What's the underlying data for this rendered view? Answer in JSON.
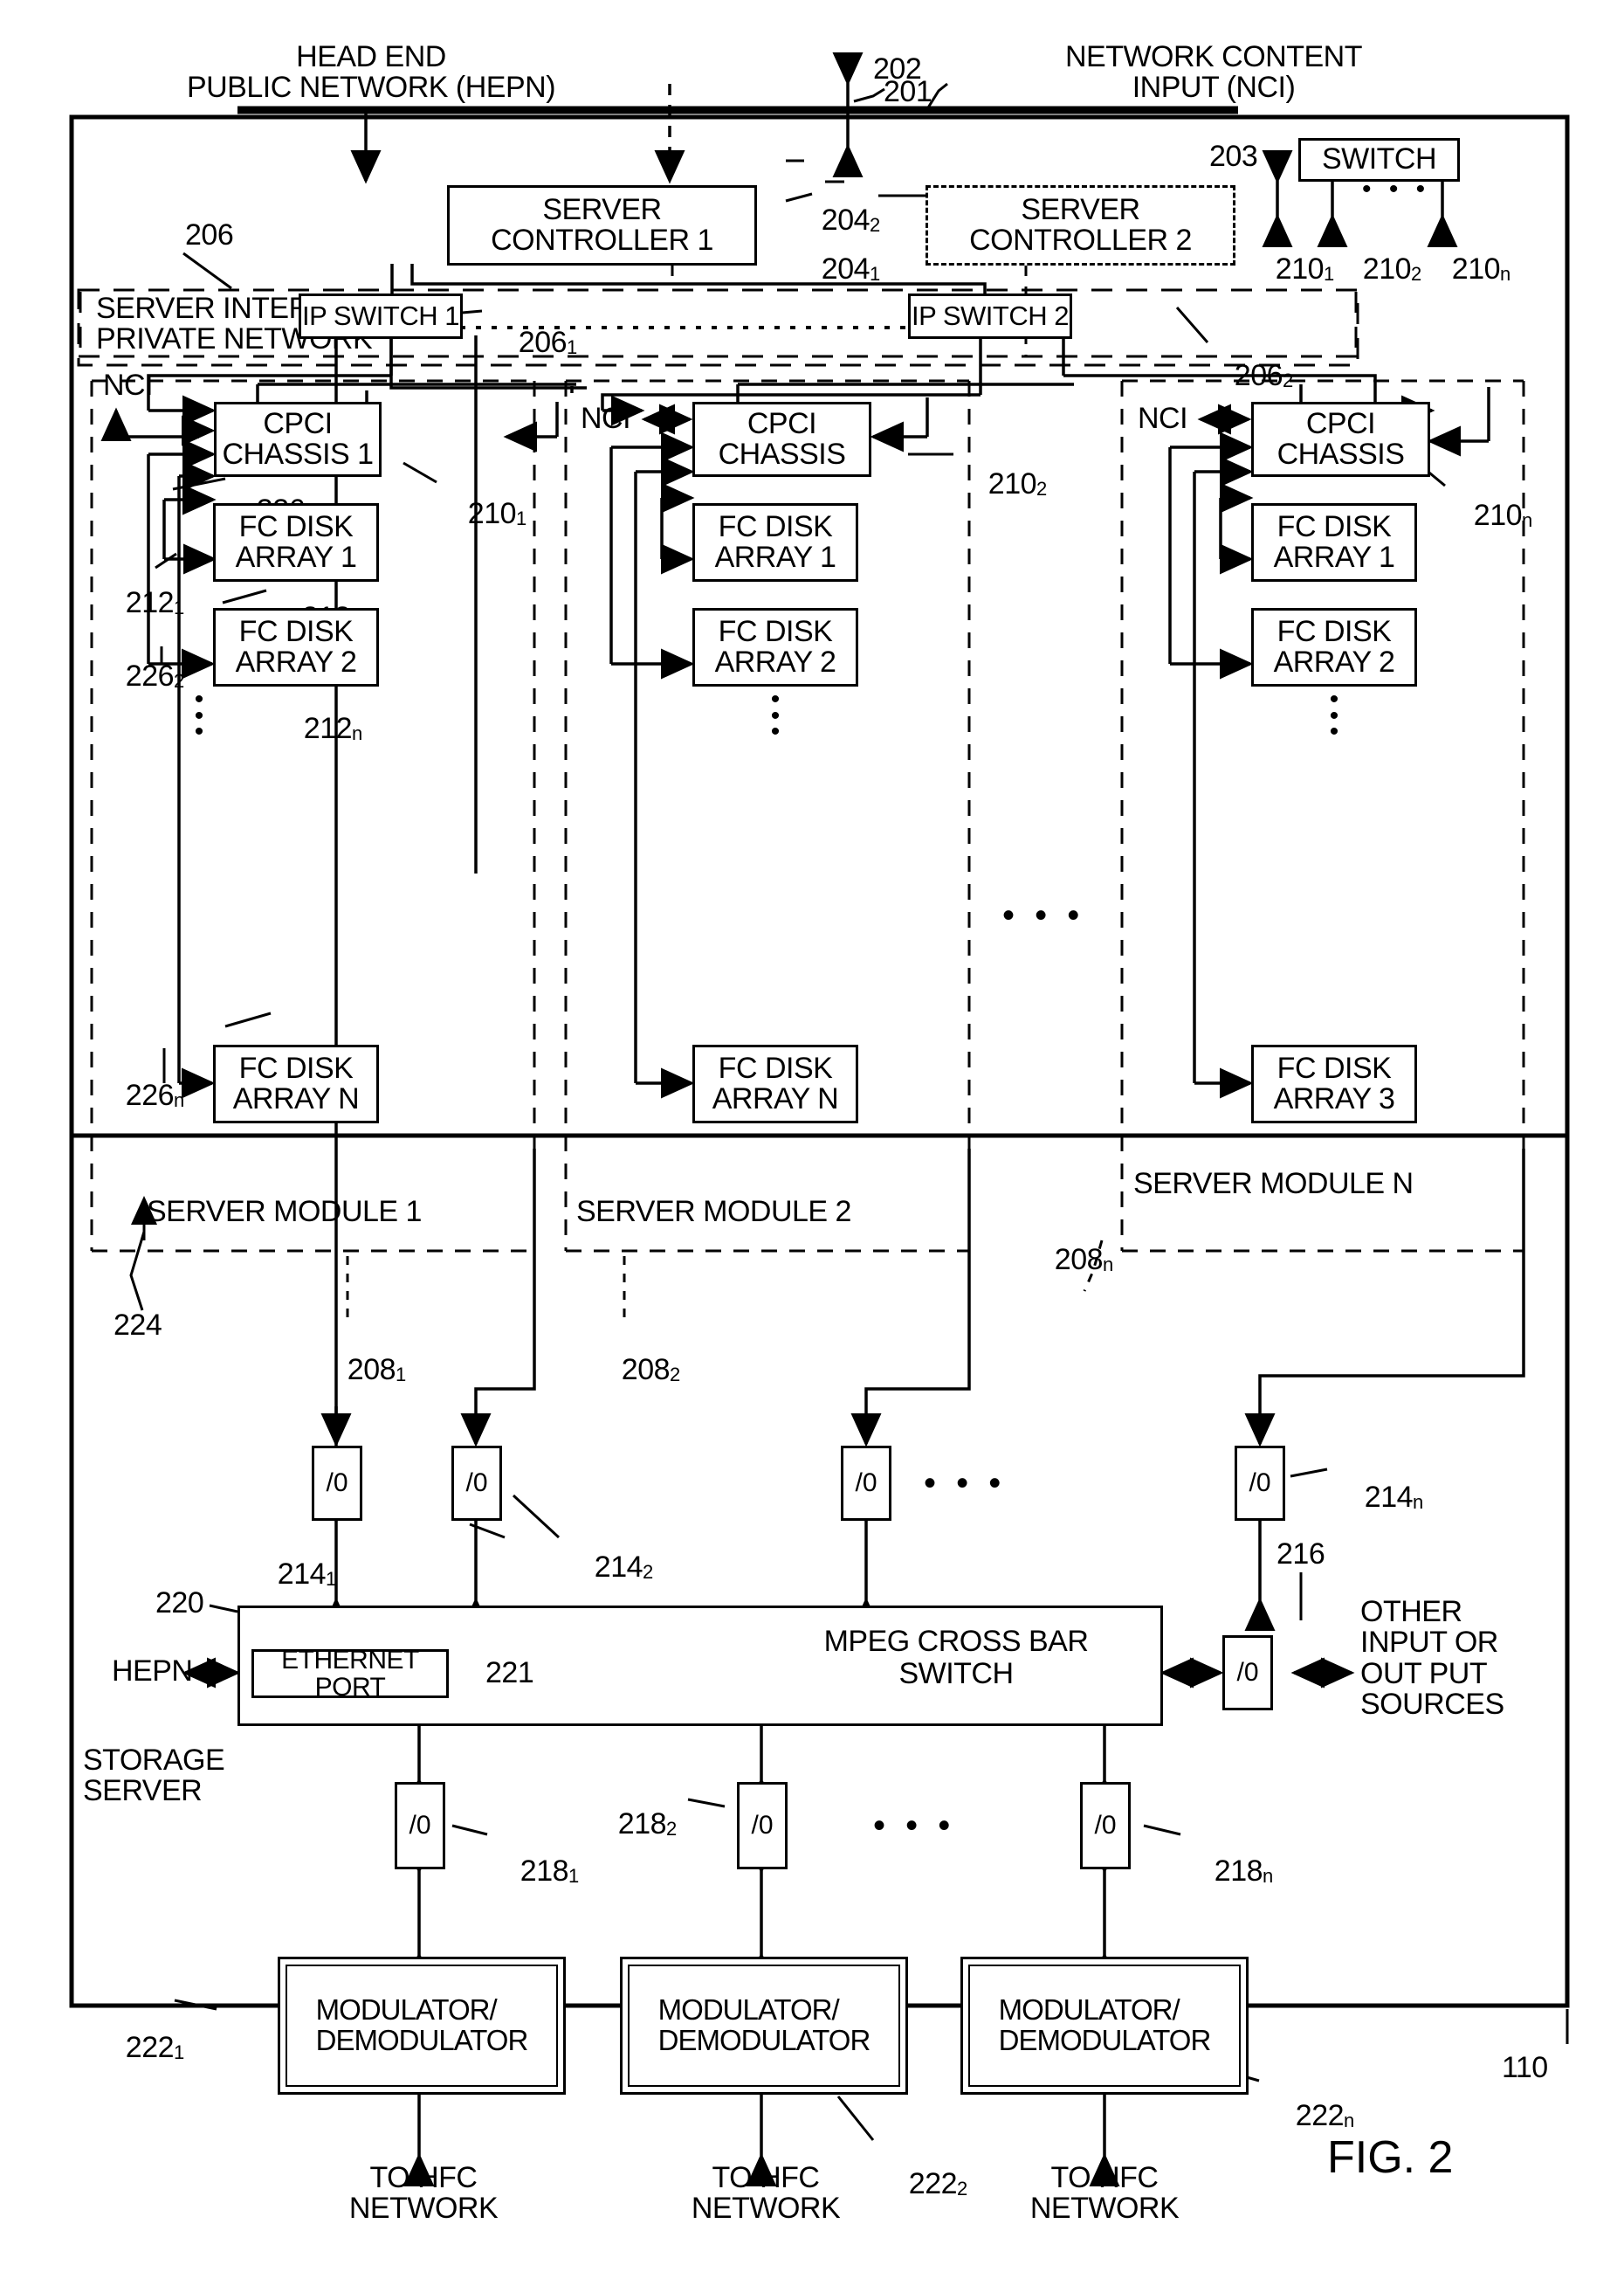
{
  "figure": {
    "number": "FIG. 2",
    "outer_ref": "110"
  },
  "top_labels": {
    "hepn": "HEAD END\nPUBLIC NETWORK (HEPN)",
    "nci": "NETWORK CONTENT\nINPUT (NCI)",
    "bus_ref": "202",
    "nci_link_ref": "201",
    "switch_ref": "203",
    "switch_label": "SWITCH"
  },
  "switch_outputs": [
    {
      "ref": "210",
      "sub": "1"
    },
    {
      "ref": "210",
      "sub": "2"
    },
    {
      "ref": "210",
      "sub": "n"
    }
  ],
  "controllers": [
    {
      "label": "SERVER\nCONTROLLER 1",
      "ref": "204",
      "sub": "1",
      "style": "solid"
    },
    {
      "label": "SERVER\nCONTROLLER 2",
      "ref": "204",
      "sub": "2",
      "style": "dashed"
    }
  ],
  "private_network": {
    "label": "SERVER INTERNAL\nPRIVATE NETWORK",
    "ref": "206",
    "switches": [
      {
        "label": "IP SWITCH 1",
        "ref": "206",
        "sub": "1"
      },
      {
        "label": "IP SWITCH 2",
        "ref": "206",
        "sub": "2"
      }
    ]
  },
  "server_modules": [
    {
      "title": "SERVER MODULE 1",
      "module_ref": "208",
      "module_sub": "1",
      "nci_label": "NCI",
      "chassis": {
        "label": "CPCI\nCHASSIS 1",
        "ref": "210",
        "sub": "1"
      },
      "disks": [
        {
          "label": "FC DISK\nARRAY 1",
          "ref": "212",
          "sub": "1",
          "link_ref": "226",
          "link_sub": "1"
        },
        {
          "label": "FC DISK\nARRAY 2",
          "ref": "212",
          "sub": "2",
          "link_ref": "226",
          "link_sub": "2"
        },
        {
          "label": "FC DISK\nARRAY N",
          "ref": "212",
          "sub": "n",
          "link_ref": "226",
          "link_sub": "n"
        }
      ],
      "fabric_ref": "224"
    },
    {
      "title": "SERVER MODULE 2",
      "module_ref": "208",
      "module_sub": "2",
      "nci_label": "NCI",
      "chassis": {
        "label": "CPCI\nCHASSIS",
        "ref": "210",
        "sub": "2"
      },
      "disks": [
        {
          "label": "FC DISK\nARRAY 1",
          "ref": "",
          "sub": "",
          "link_ref": "",
          "link_sub": ""
        },
        {
          "label": "FC DISK\nARRAY 2",
          "ref": "",
          "sub": "",
          "link_ref": "",
          "link_sub": ""
        },
        {
          "label": "FC DISK\nARRAY N",
          "ref": "",
          "sub": "",
          "link_ref": "",
          "link_sub": ""
        }
      ],
      "fabric_ref": ""
    },
    {
      "title": "SERVER MODULE N",
      "module_ref": "208",
      "module_sub": "n",
      "nci_label": "NCI",
      "chassis": {
        "label": "CPCI\nCHASSIS",
        "ref": "210",
        "sub": "n"
      },
      "disks": [
        {
          "label": "FC DISK\nARRAY 1",
          "ref": "",
          "sub": "",
          "link_ref": "",
          "link_sub": ""
        },
        {
          "label": "FC DISK\nARRAY 2",
          "ref": "",
          "sub": "",
          "link_ref": "",
          "link_sub": ""
        },
        {
          "label": "FC DISK\nARRAY 3",
          "ref": "",
          "sub": "",
          "link_ref": "",
          "link_sub": ""
        }
      ],
      "fabric_ref": ""
    }
  ],
  "upper_io": [
    {
      "label": "/0",
      "ref": "214",
      "sub": "1"
    },
    {
      "label": "/0",
      "ref": "214",
      "sub": "2"
    },
    {
      "label": "/0",
      "ref": "214",
      "sub": "n"
    }
  ],
  "crossbar": {
    "label": "MPEG CROSS BAR\nSWITCH",
    "ref": "220",
    "ethernet_port": {
      "label": "ETHERNET PORT",
      "ref": "221"
    },
    "hepn_label": "HEPN",
    "storage_server_label": "STORAGE\nSERVER",
    "side_io": {
      "label": "/0",
      "ref": "216"
    },
    "other_sources_label": "OTHER\nINPUT OR\nOUT PUT\nSOURCES"
  },
  "lower_io": [
    {
      "label": "/0",
      "ref": "218",
      "sub": "1"
    },
    {
      "label": "/0",
      "ref": "218",
      "sub": "2"
    },
    {
      "label": "/0",
      "ref": "218",
      "sub": "n"
    }
  ],
  "modems": [
    {
      "label": "MODULATOR/\nDEMODULATOR",
      "ref": "222",
      "sub": "1",
      "out": "TO HFC\nNETWORK"
    },
    {
      "label": "MODULATOR/\nDEMODULATOR",
      "ref": "222",
      "sub": "2",
      "out": "TO HFC\nNETWORK"
    },
    {
      "label": "MODULATOR/\nDEMODULATOR",
      "ref": "222",
      "sub": "n",
      "out": "TO HFC\nNETWORK"
    }
  ],
  "ellipsis": "• • •",
  "vertical_ellipsis": "•\n•\n•"
}
